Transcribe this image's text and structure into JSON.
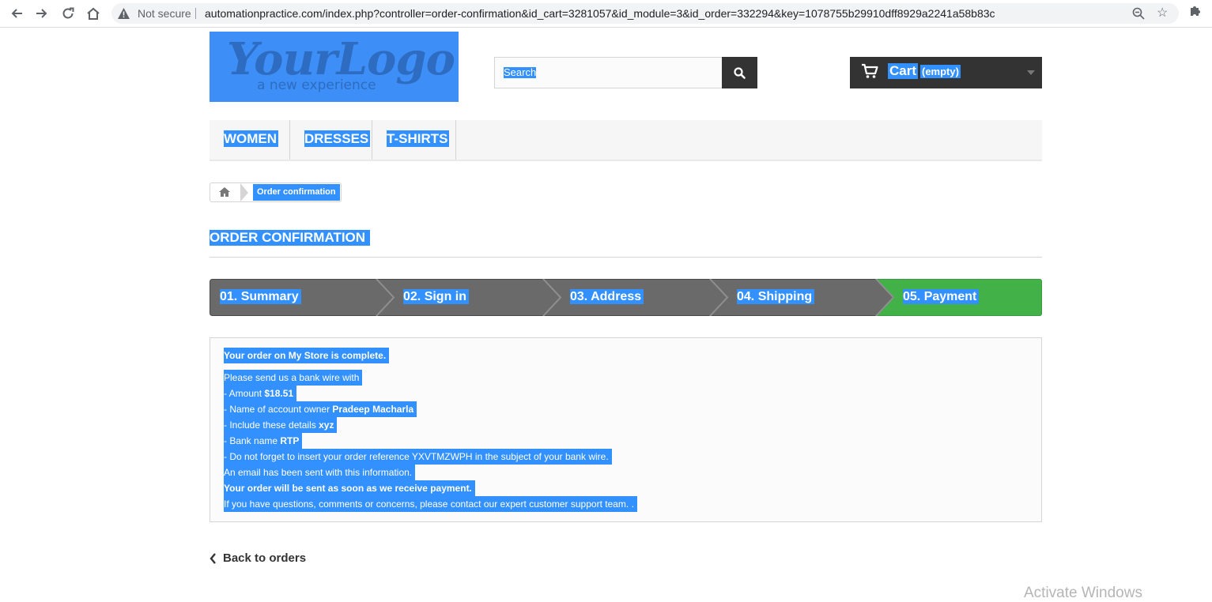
{
  "browser": {
    "security_label": "Not secure",
    "url": "automationpractice.com/index.php?controller=order-confirmation&id_cart=3281057&id_module=3&id_order=332294&key=1078755b29910dff8929a2241a58b83c"
  },
  "header": {
    "logo_text": "YourLogo",
    "logo_tagline": "a new experience",
    "search_placeholder": "Search",
    "cart_label": "Cart",
    "cart_count": "(empty)"
  },
  "menu": {
    "items": [
      {
        "label": "WOMEN"
      },
      {
        "label": "DRESSES"
      },
      {
        "label": "T-SHIRTS"
      }
    ]
  },
  "breadcrumb": {
    "current": "Order confirmation"
  },
  "page": {
    "title": "ORDER CONFIRMATION"
  },
  "steps": [
    {
      "label": "01. Summary"
    },
    {
      "label": "02. Sign in"
    },
    {
      "label": "03. Address"
    },
    {
      "label": "04. Shipping"
    },
    {
      "label": "05. Payment"
    }
  ],
  "confirmation": {
    "complete_text": "Your order on My Store is complete.",
    "intro": "Please send us a bank wire with",
    "amount_label": "- Amount",
    "amount_value": "$18.51",
    "owner_label": "- Name of account owner",
    "owner_value": "Pradeep Macharla",
    "details_label": "- Include these details",
    "details_value": "xyz",
    "bank_label": "- Bank name",
    "bank_value": "RTP",
    "reference_text": "- Do not forget to insert your order reference YXVTMZWPH in the subject of your bank wire.",
    "email_text": "An email has been sent with this information.",
    "shipping_text": "Your order will be sent as soon as we receive payment.",
    "support_text": "If you have questions, comments or concerns, please contact our expert customer support team. ."
  },
  "back_link": "Back to orders",
  "watermark": "Activate Windows",
  "colors": {
    "selection": "#3390ff",
    "dark": "#333333",
    "step_inactive": "#6a6a6a",
    "step_active": "#41b148"
  }
}
